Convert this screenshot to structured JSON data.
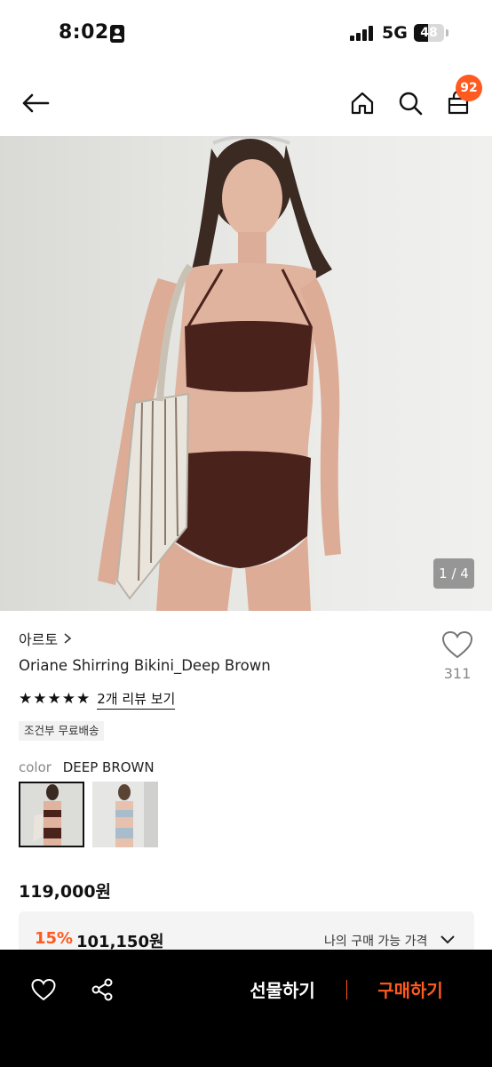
{
  "status_bar": {
    "time": "8:02",
    "network": "5G",
    "battery": "48",
    "battery_level": 0.48
  },
  "header": {
    "back_icon": "arrow-left-icon",
    "home_icon": "home-icon",
    "search_icon": "search-icon",
    "cart_icon": "shopping-bag-icon",
    "cart_count": "92"
  },
  "gallery": {
    "counter": "1 / 4"
  },
  "product": {
    "brand": "아르토",
    "title": "Oriane Shirring Bikini_Deep Brown",
    "wishlist_count": "311",
    "rating_stars": 5,
    "review_link": "2개 리뷰 보기",
    "shipping_badge": "조건부 무료배송",
    "color_label": "color",
    "color_value": "DEEP BROWN",
    "price": "119,000원",
    "discount_percent": "15%",
    "discount_price": "101,150원",
    "my_price_label": "나의 구매 가능 가격"
  },
  "bottom_bar": {
    "gift_label": "선물하기",
    "buy_label": "구매하기"
  },
  "colors": {
    "accent": "#ff5a1f",
    "bottom_bar_bg": "#000000"
  }
}
